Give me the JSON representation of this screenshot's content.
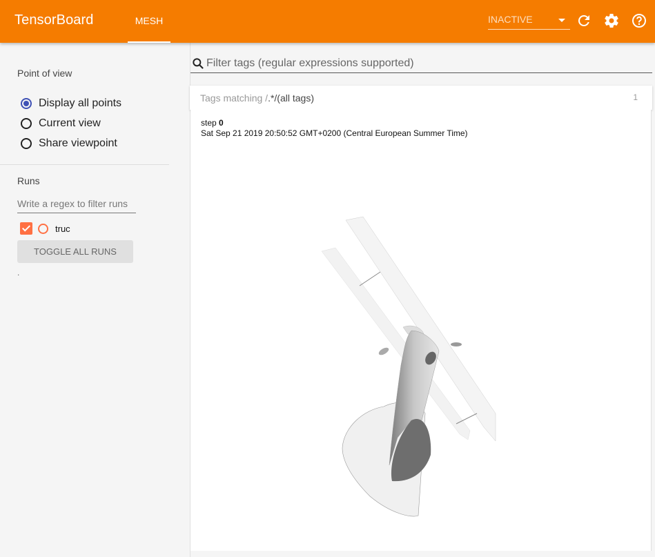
{
  "header": {
    "brand": "TensorBoard",
    "tabs": [
      {
        "label": "MESH",
        "active": true
      }
    ],
    "run_selector": {
      "value": "INACTIVE"
    },
    "icons": [
      "refresh-icon",
      "settings-icon",
      "help-icon"
    ],
    "colors": {
      "bar": "#f57c00"
    }
  },
  "sidebar": {
    "point_of_view": {
      "title": "Point of view",
      "options": [
        {
          "label": "Display all points",
          "checked": true
        },
        {
          "label": "Current view",
          "checked": false
        },
        {
          "label": "Share viewpoint",
          "checked": false
        }
      ]
    },
    "runs": {
      "title": "Runs",
      "filter_placeholder": "Write a regex to filter runs",
      "items": [
        {
          "name": "truc",
          "checked": true,
          "color": "#ff7043"
        }
      ],
      "toggle_label": "TOGGLE ALL RUNS",
      "footer": "."
    }
  },
  "main": {
    "filter_placeholder": "Filter tags (regular expressions supported)",
    "card": {
      "prefix": "Tags matching /",
      "pattern": ".*",
      "suffix": "/(all tags)",
      "count": "1",
      "step_label": "step",
      "step_value": "0",
      "timestamp": "Sat Sep 21 2019 20:50:52 GMT+0200 (Central European Summer Time)"
    }
  }
}
